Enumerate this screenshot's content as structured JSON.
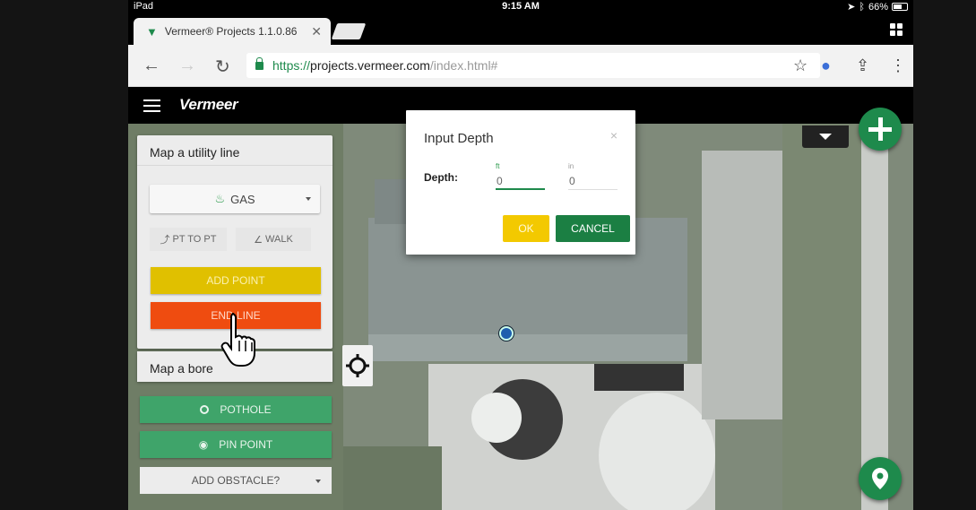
{
  "status_bar": {
    "device": "iPad",
    "time": "9:15 AM",
    "battery": "66%",
    "battery_level": 0.66
  },
  "browser": {
    "tab_title": "Vermeer® Projects 1.1.0.86",
    "url_scheme": "https://",
    "url_host": "projects.vermeer.com",
    "url_path": "/index.html#"
  },
  "app": {
    "brand": "Vermeer"
  },
  "utility_panel": {
    "title": "Map a utility line",
    "utility_type": "GAS",
    "pt_to_pt": "PT TO PT",
    "walk": "WALK",
    "add_point": "ADD POINT",
    "end_line": "END LINE"
  },
  "bore_panel": {
    "title": "Map a bore",
    "pothole": "POTHOLE",
    "pin_point": "PIN POINT",
    "add_obstacle": "ADD OBSTACLE?"
  },
  "dialog": {
    "title": "Input Depth",
    "close": "×",
    "depth_label": "Depth:",
    "ft_unit": "ft",
    "in_unit": "in",
    "ft_value": "0",
    "in_value": "0",
    "ok": "OK",
    "cancel": "CANCEL"
  },
  "colors": {
    "brand_green": "#1e8a4c",
    "add_point_yellow": "#e0c000",
    "end_line_orange": "#ef4c10",
    "pothole_green": "#3fa46a",
    "ok_yellow": "#f3c900"
  }
}
